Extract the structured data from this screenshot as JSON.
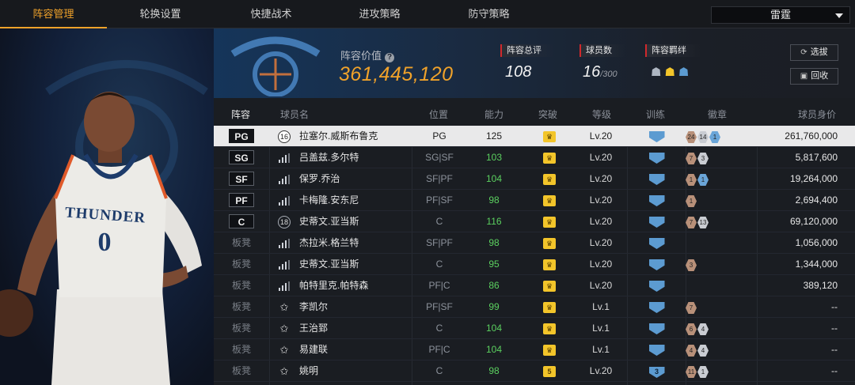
{
  "nav": {
    "tabs": [
      "阵容管理",
      "轮换设置",
      "快捷战术",
      "进攻策略",
      "防守策略"
    ],
    "active": 0,
    "team_select": "雷霆"
  },
  "header": {
    "value_label": "阵容价值",
    "value": "361,445,120",
    "overall_label": "阵容总评",
    "overall": "108",
    "players_label": "球员数",
    "players": "16",
    "players_max": "/300",
    "bond_label": "阵容羁绊",
    "btn_draft": "选拔",
    "btn_recycle": "回收"
  },
  "table_headers": [
    "阵容",
    "球员名",
    "位置",
    "能力",
    "突破",
    "等级",
    "训练",
    "徽章",
    "球员身价"
  ],
  "rows": [
    {
      "slot": "PG",
      "bench": false,
      "icon": "number",
      "num": "16",
      "name": "拉塞尔.威斯布鲁克",
      "role": "PG",
      "rating": "125",
      "break": "crown",
      "level": "Lv.20",
      "train": "",
      "badges": [
        [
          "b",
          "24"
        ],
        [
          "s",
          "14"
        ],
        [
          "g",
          "1"
        ]
      ],
      "value": "261,760,000"
    },
    {
      "slot": "SG",
      "bench": false,
      "icon": "bars",
      "num": "",
      "name": "吕盖兹.多尔特",
      "role": "SG|SF",
      "rating": "103",
      "break": "crown",
      "level": "Lv.20",
      "train": "",
      "badges": [
        [
          "b",
          "7"
        ],
        [
          "s",
          "3"
        ]
      ],
      "value": "5,817,600"
    },
    {
      "slot": "SF",
      "bench": false,
      "icon": "bars",
      "num": "",
      "name": "保罗.乔治",
      "role": "SF|PF",
      "rating": "104",
      "break": "crown",
      "level": "Lv.20",
      "train": "",
      "badges": [
        [
          "b",
          "1"
        ],
        [
          "g",
          "1"
        ]
      ],
      "value": "19,264,000"
    },
    {
      "slot": "PF",
      "bench": false,
      "icon": "bars",
      "num": "",
      "name": "卡梅隆.安东尼",
      "role": "PF|SF",
      "rating": "98",
      "break": "crown",
      "level": "Lv.20",
      "train": "",
      "badges": [
        [
          "b",
          "1"
        ]
      ],
      "value": "2,694,400"
    },
    {
      "slot": "C",
      "bench": false,
      "icon": "number",
      "num": "18",
      "name": "史蒂文.亚当斯",
      "role": "C",
      "rating": "116",
      "break": "crown",
      "level": "Lv.20",
      "train": "",
      "badges": [
        [
          "b",
          "7"
        ],
        [
          "s",
          "13"
        ]
      ],
      "value": "69,120,000"
    },
    {
      "slot": "板凳",
      "bench": true,
      "icon": "bars",
      "num": "",
      "name": "杰拉米.格兰特",
      "role": "SF|PF",
      "rating": "98",
      "break": "crown",
      "level": "Lv.20",
      "train": "",
      "badges": [],
      "value": "1,056,000"
    },
    {
      "slot": "板凳",
      "bench": true,
      "icon": "bars",
      "num": "",
      "name": "史蒂文.亚当斯",
      "role": "C",
      "rating": "95",
      "break": "crown",
      "level": "Lv.20",
      "train": "",
      "badges": [
        [
          "b",
          "3"
        ]
      ],
      "value": "1,344,000"
    },
    {
      "slot": "板凳",
      "bench": true,
      "icon": "bars",
      "num": "",
      "name": "帕特里克.帕特森",
      "role": "PF|C",
      "rating": "86",
      "break": "crown",
      "level": "Lv.20",
      "train": "",
      "badges": [],
      "value": "389,120"
    },
    {
      "slot": "板凳",
      "bench": true,
      "icon": "star",
      "num": "",
      "name": "李凯尔",
      "role": "PF|SF",
      "rating": "99",
      "break": "crown",
      "level": "Lv.1",
      "train": "",
      "badges": [
        [
          "b",
          "7"
        ]
      ],
      "value": "--"
    },
    {
      "slot": "板凳",
      "bench": true,
      "icon": "star",
      "num": "",
      "name": "王治郅",
      "role": "C",
      "rating": "104",
      "break": "crown",
      "level": "Lv.1",
      "train": "",
      "badges": [
        [
          "b",
          "6"
        ],
        [
          "s",
          "4"
        ]
      ],
      "value": "--"
    },
    {
      "slot": "板凳",
      "bench": true,
      "icon": "star",
      "num": "",
      "name": "易建联",
      "role": "PF|C",
      "rating": "104",
      "break": "crown",
      "level": "Lv.1",
      "train": "",
      "badges": [
        [
          "b",
          "4"
        ],
        [
          "s",
          "4"
        ]
      ],
      "value": "--"
    },
    {
      "slot": "板凳",
      "bench": true,
      "icon": "star",
      "num": "",
      "name": "姚明",
      "role": "C",
      "rating": "98",
      "break": "5",
      "level": "Lv.20",
      "train": "3",
      "badges": [
        [
          "b",
          "11"
        ],
        [
          "s",
          "1"
        ]
      ],
      "value": "--"
    }
  ],
  "colors": {
    "accent": "#f0a22a",
    "rating_green": "#5bd05f",
    "crown": "#f3c52a",
    "shield": "#5c9bd1",
    "tag_red": "#d0282c"
  },
  "portrait": {
    "jersey_text": "THUNDER",
    "jersey_number": "0"
  }
}
